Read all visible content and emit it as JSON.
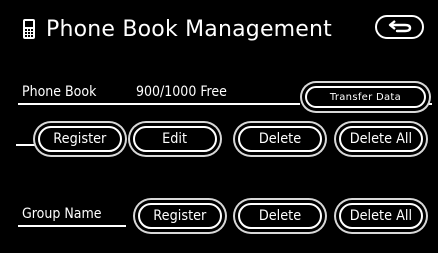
{
  "header": {
    "title": "Phone Book Management",
    "back_icon": "return-arrow-icon",
    "phone_icon": "phone-handset-icon"
  },
  "phone_book": {
    "label": "Phone Book",
    "capacity": "900/1000 Free",
    "transfer_label": "Transfer Data",
    "buttons": [
      "Register",
      "Edit",
      "Delete",
      "Delete All"
    ]
  },
  "group_name": {
    "label": "Group Name",
    "buttons": [
      "Register",
      "Delete",
      "Delete All"
    ]
  },
  "colors": {
    "background": "#000000",
    "foreground": "#ffffff",
    "button_outer": "#d8d8d8"
  }
}
